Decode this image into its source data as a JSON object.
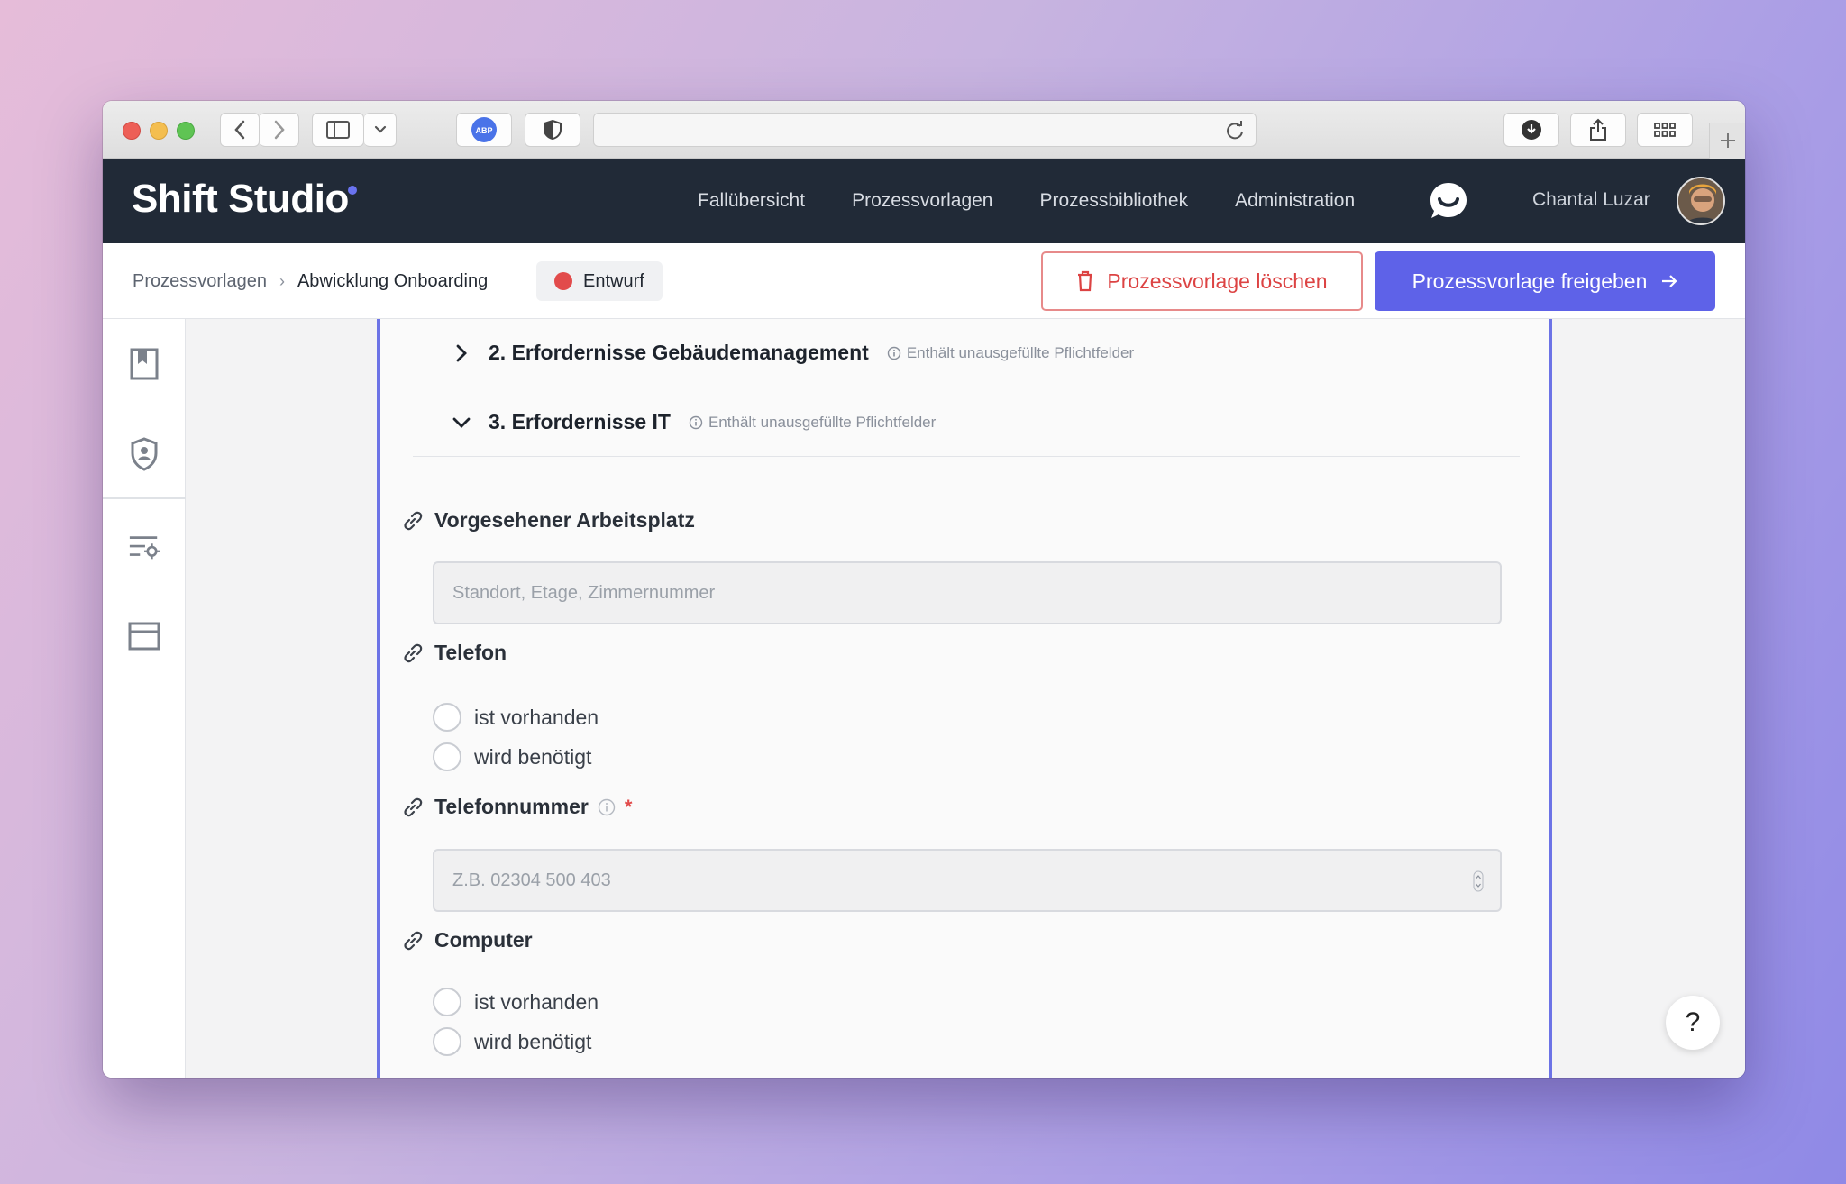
{
  "header": {
    "brand": "Shift Studio",
    "nav": [
      "Fallübersicht",
      "Prozessvorlagen",
      "Prozessbibliothek",
      "Administration"
    ],
    "user_name": "Chantal Luzar"
  },
  "subheader": {
    "breadcrumb_parent": "Prozessvorlagen",
    "breadcrumb_current": "Abwicklung Onboarding",
    "status": "Entwurf",
    "delete_label": "Prozessvorlage löschen",
    "release_label": "Prozessvorlage freigeben"
  },
  "sections": [
    {
      "title": "2. Erfordernisse Gebäudemanagement",
      "hint": "Enthält unausgefüllte Pflichtfelder",
      "expanded": false
    },
    {
      "title": "3. Erfordernisse IT",
      "hint": "Enthält unausgefüllte Pflichtfelder",
      "expanded": true
    }
  ],
  "fields": {
    "workplace": {
      "label": "Vorgesehener Arbeitsplatz",
      "placeholder": "Standort, Etage, Zimmernummer"
    },
    "phone": {
      "label": "Telefon",
      "options": [
        "ist vorhanden",
        "wird benötigt"
      ]
    },
    "phone_number": {
      "label": "Telefonnummer",
      "required": "*",
      "placeholder": "Z.B. 02304 500 403"
    },
    "computer": {
      "label": "Computer",
      "options": [
        "ist vorhanden",
        "wird benötigt"
      ]
    }
  },
  "help_label": "?",
  "colors": {
    "accent": "#5e62e8",
    "danger": "#dc4343",
    "header_bg": "#212a37",
    "panel_border": "#6c73e6"
  }
}
